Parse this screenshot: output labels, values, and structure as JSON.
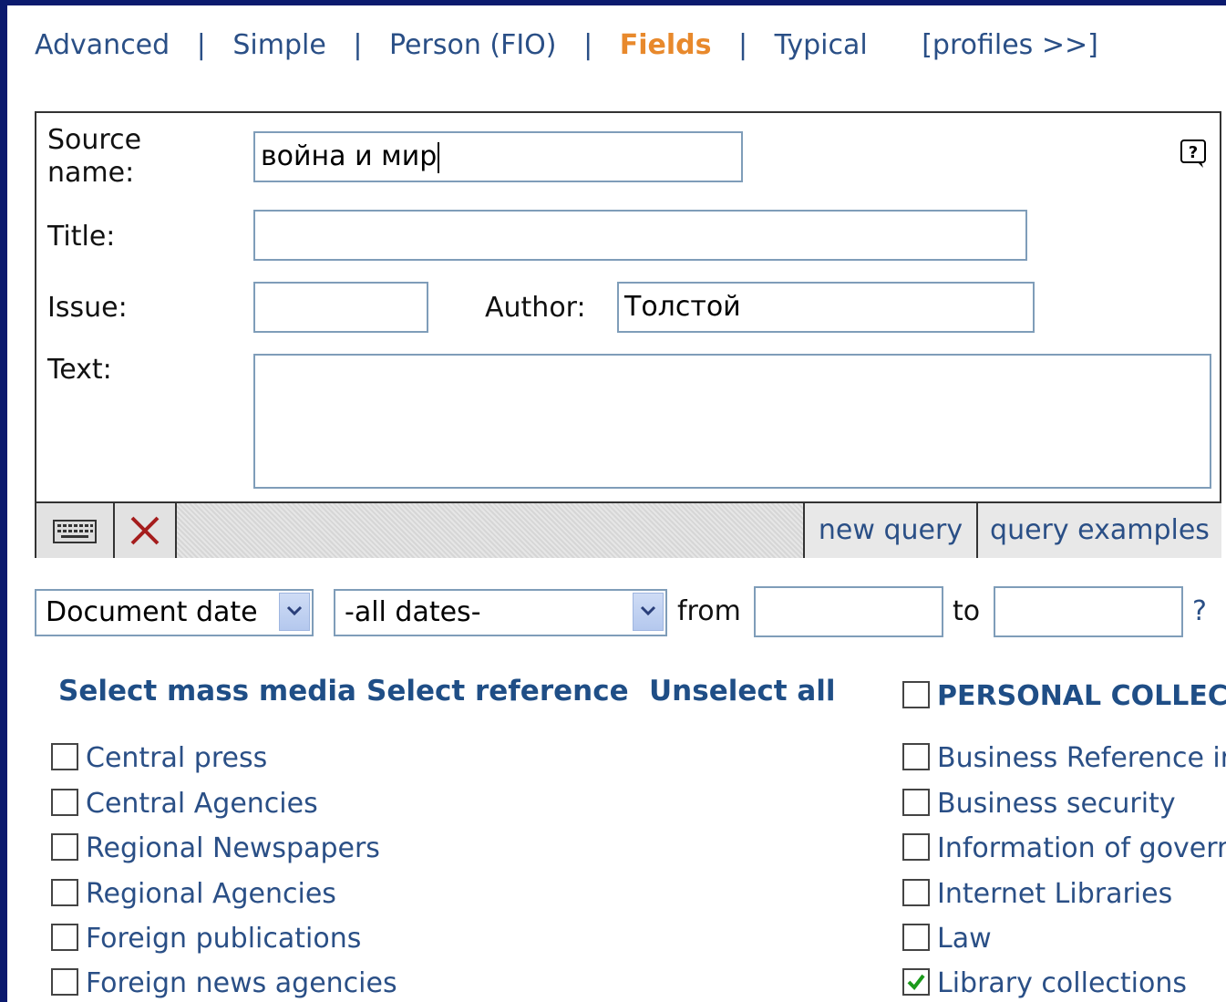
{
  "nav": {
    "items": [
      "Advanced",
      "Simple",
      "Person (FIO)",
      "Fields",
      "Typical"
    ],
    "separator": "|",
    "active": "Fields",
    "profiles": "[profiles >>]"
  },
  "form": {
    "source_label": "Source name:",
    "source_value": "война и мир",
    "title_label": "Title:",
    "title_value": "",
    "issue_label": "Issue:",
    "issue_value": "",
    "author_label": "Author:",
    "author_value": "Толстой",
    "text_label": "Text:",
    "text_value": ""
  },
  "toolbar": {
    "new_query": "new query",
    "query_examples": "query examples"
  },
  "dates": {
    "type_value": "Document date",
    "range_value": "-all dates-",
    "from_label": "from",
    "from_value": "",
    "to_label": "to",
    "to_value": "",
    "help": "?"
  },
  "select_links": {
    "mass_media": "Select mass media",
    "reference": "Select reference",
    "unselect": "Unselect all"
  },
  "left_list": [
    {
      "label": "Central press",
      "checked": false
    },
    {
      "label": "Central Agencies",
      "checked": false
    },
    {
      "label": "Regional Newspapers",
      "checked": false
    },
    {
      "label": "Regional Agencies",
      "checked": false
    },
    {
      "label": "Foreign publications",
      "checked": false
    },
    {
      "label": "Foreign news agencies",
      "checked": false
    }
  ],
  "personal": {
    "title": "PERSONAL COLLECT",
    "items": [
      {
        "label": "Business Reference ir",
        "checked": false
      },
      {
        "label": "Business security",
        "checked": false
      },
      {
        "label": "Information of goverr",
        "checked": false
      },
      {
        "label": "Internet Libraries",
        "checked": false
      },
      {
        "label": "Law",
        "checked": false
      },
      {
        "label": "Library collections",
        "checked": true
      }
    ]
  },
  "colors": {
    "link": "#2a4f86",
    "active_tab": "#e8892c",
    "background": "#0b1a6e",
    "check": "#1a9a1a"
  }
}
